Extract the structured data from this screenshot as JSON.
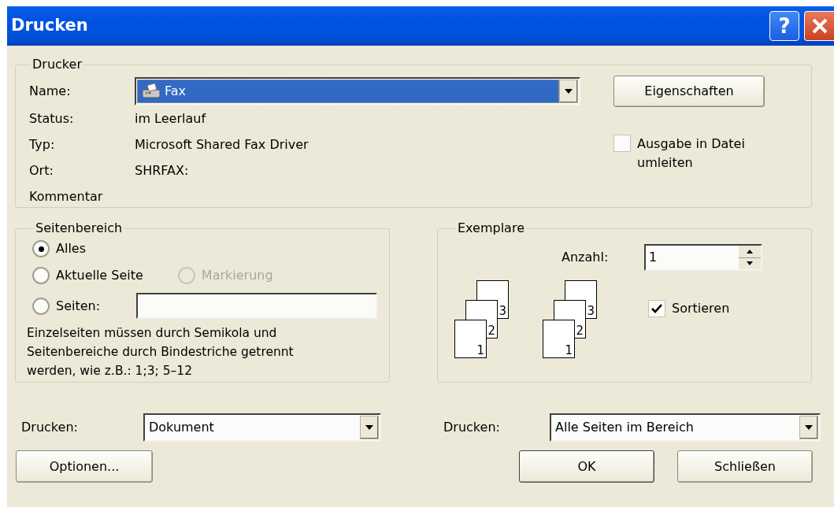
{
  "window": {
    "title": "Drucken"
  },
  "title_buttons": [
    {
      "kind": "help",
      "label": "?"
    },
    {
      "kind": "close"
    }
  ],
  "printer": {
    "legend": "Drucker",
    "name_label": "Name:",
    "name_value": "Fax",
    "fields": [
      {
        "label": "Status:",
        "value": "im Leerlauf"
      },
      {
        "label": "Typ:",
        "value": "Microsoft Shared Fax Driver"
      },
      {
        "label": "Ort:",
        "value": "SHRFAX:"
      },
      {
        "label": "Kommentar"
      }
    ],
    "properties_button": "Eigenschaften",
    "print_to_file": {
      "label": "Ausgabe in Datei umleiten",
      "checked": false
    }
  },
  "page_range": {
    "legend": "Seitenbereich",
    "options": [
      {
        "label": "Alles",
        "selected": true,
        "disabled": false
      },
      {
        "label": "Aktuelle Seite",
        "selected": false,
        "disabled": false
      },
      {
        "label": "Markierung",
        "selected": false,
        "disabled": true
      },
      {
        "label": "Seiten:",
        "selected": false,
        "disabled": false
      }
    ],
    "note": "Einzelseiten müssen durch Semikola und Seitenbereiche durch Bindestriche getrennt werden, wie z.B.: 1;3; 5–12"
  },
  "copies": {
    "legend": "Exemplare",
    "count_label": "Anzahl:",
    "count_value": "1",
    "collate_icons": [
      {
        "pages": [
          "3",
          "2",
          "1"
        ]
      },
      {
        "pages": [
          "3",
          "2",
          "1"
        ]
      }
    ],
    "collate": {
      "label": "Sortieren",
      "checked": true
    }
  },
  "print_what": {
    "label": "Drucken:",
    "value": "Dokument"
  },
  "print_pages": {
    "label": "Drucken:",
    "value": "Alle Seiten im Bereich"
  },
  "buttons": [
    {
      "label": "Optionen..."
    },
    {
      "label": "OK"
    },
    {
      "label": "Schließen"
    }
  ]
}
